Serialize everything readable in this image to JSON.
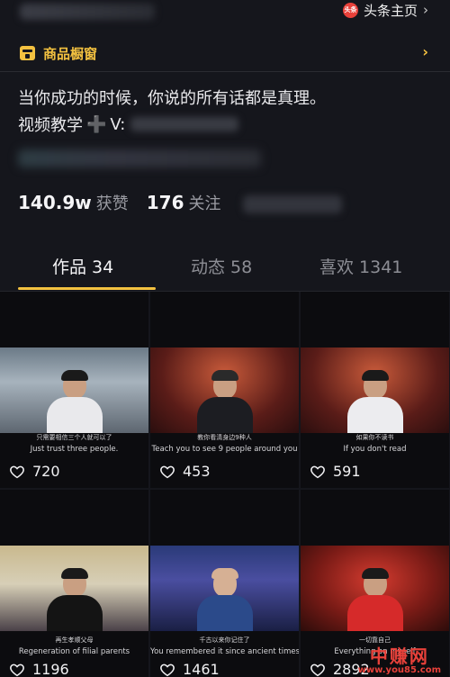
{
  "header": {
    "toutiao_logo_text": "头条",
    "toutiao_link_label": "头条主页",
    "toutiao_chevron": "›"
  },
  "shop": {
    "label": "商品橱窗",
    "chevron": "›",
    "accent_color": "#f3c140"
  },
  "bio": {
    "line1": "当你成功的时候，你说的所有话都是真理。",
    "line2_prefix": "视频教学",
    "line2_icon": "➕",
    "line2_contact_prefix": "V: "
  },
  "stats": {
    "likes_count": "140.9w",
    "likes_label": "获赞",
    "following_count": "176",
    "following_label": "关注"
  },
  "tabs": [
    {
      "label": "作品",
      "count": "34",
      "active": true
    },
    {
      "label": "动态",
      "count": "58",
      "active": false
    },
    {
      "label": "喜欢",
      "count": "1341",
      "active": false
    }
  ],
  "videos": [
    {
      "subtitle_cn": "只需要相信三个人就可以了",
      "subtitle_en": "Just trust three people.",
      "likes": "720"
    },
    {
      "subtitle_cn": "教你看清身边9种人",
      "subtitle_en": "Teach you to see 9 people around you",
      "likes": "453"
    },
    {
      "subtitle_cn": "如果你不读书",
      "subtitle_en": "If you don't read",
      "likes": "591"
    },
    {
      "subtitle_cn": "再生孝顺父母",
      "subtitle_en": "Regeneration of filial parents",
      "likes": "1196"
    },
    {
      "subtitle_cn": "千古以来你记住了",
      "subtitle_en": "You remembered it since ancient times.",
      "likes": "1461"
    },
    {
      "subtitle_cn": "一切靠自己",
      "subtitle_en": "Everything on myself",
      "likes": "2892"
    }
  ],
  "watermark": {
    "text": "中赚网",
    "url": "www.you85.com",
    "color": "#e8413a"
  }
}
